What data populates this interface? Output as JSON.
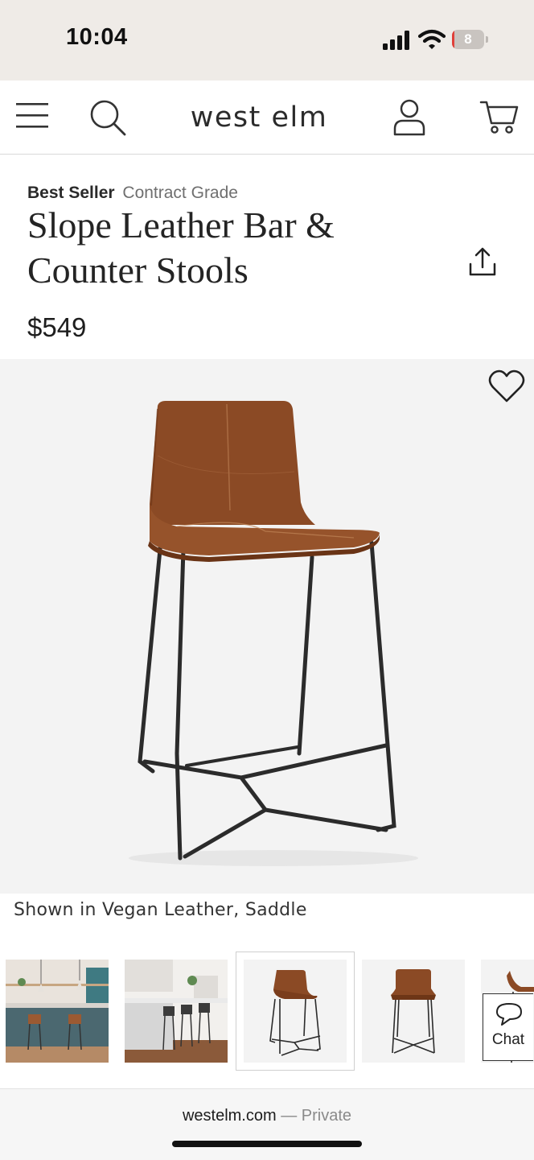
{
  "status_bar": {
    "time": "10:04",
    "battery_level": "8",
    "battery_fraction": 0.08
  },
  "header": {
    "brand": "west elm",
    "icons": [
      "menu-icon",
      "search-icon",
      "account-icon",
      "cart-icon"
    ]
  },
  "product": {
    "badge_primary": "Best Seller",
    "badge_secondary": "Contract Grade",
    "title": "Slope Leather Bar & Counter Stools",
    "price": "$549",
    "caption": "Shown in Vegan Leather, Saddle",
    "thumbnails": [
      "kitchen scene",
      "kitchen island scene",
      "stool front",
      "stool front"
    ],
    "selected_thumbnail": 2
  },
  "chat": {
    "label": "Chat"
  },
  "browser": {
    "domain": "westelm.com",
    "separator": "—",
    "mode": "Private"
  },
  "colors": {
    "leather": "#8b4a25",
    "frame": "#2b2b2b",
    "status_bg": "#efebe7",
    "battery_low": "#e0403a"
  }
}
